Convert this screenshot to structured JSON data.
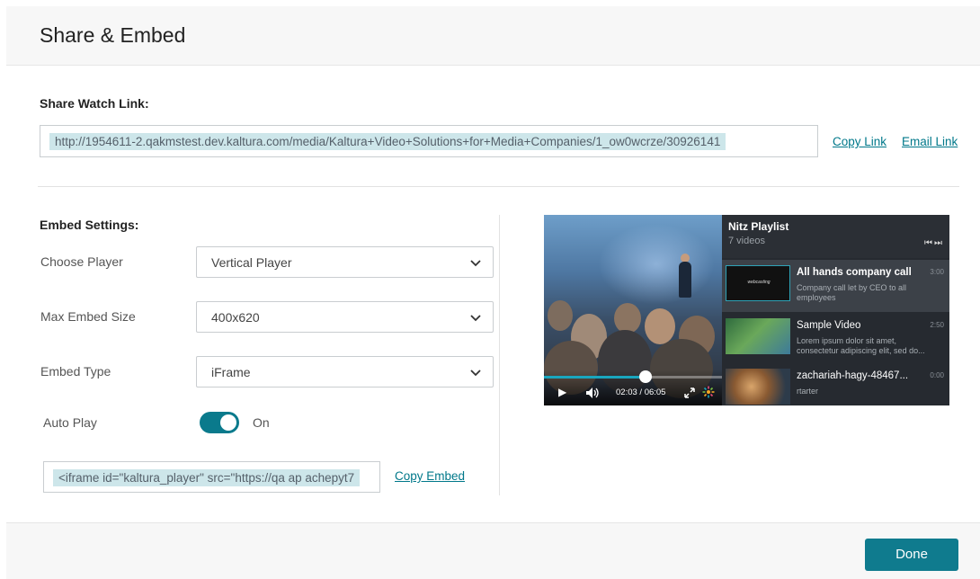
{
  "dialog": {
    "title": "Share & Embed"
  },
  "share": {
    "section_label": "Share Watch Link:",
    "link_url": "http://1954611-2.qakmstest.dev.kaltura.com/media/Kaltura+Video+Solutions+for+Media+Companies/1_ow0wcrze/30926141",
    "copy_link_label": "Copy Link",
    "email_link_label": "Email Link"
  },
  "embed": {
    "section_label": "Embed Settings:",
    "choose_player": {
      "label": "Choose Player",
      "value": "Vertical Player"
    },
    "max_embed_size": {
      "label": "Max Embed Size",
      "value": "400x620"
    },
    "embed_type": {
      "label": "Embed Type",
      "value": "iFrame"
    },
    "auto_play": {
      "label": "Auto Play",
      "state_label": "On",
      "enabled": true
    },
    "embed_code": "<iframe id=\"kaltura_player\" src=\"https://qa ap achepyt7",
    "copy_embed_label": "Copy Embed"
  },
  "player_preview": {
    "playlist_title": "Nitz Playlist",
    "playlist_count": "7 videos",
    "nav_icons": "prev-next-icons",
    "progress": 0.57,
    "time_display": "02:03 / 06:05",
    "items": [
      {
        "title": "All hands company call",
        "description": "Company call let by CEO to all employees",
        "duration": "3:00",
        "thumb_label": "webcasting",
        "active": true
      },
      {
        "title": "Sample Video",
        "description": "Lorem ipsum dolor sit amet, consectetur adipiscing elit, sed do...",
        "duration": "2:50",
        "active": false
      },
      {
        "title": "zachariah-hagy-48467...",
        "description": "rtarter",
        "duration": "0:00",
        "active": false
      }
    ]
  },
  "footer": {
    "done_label": "Done"
  },
  "colors": {
    "accent": "#0f7b8e",
    "link": "#00788a",
    "selection_highlight": "#cde6ea"
  }
}
